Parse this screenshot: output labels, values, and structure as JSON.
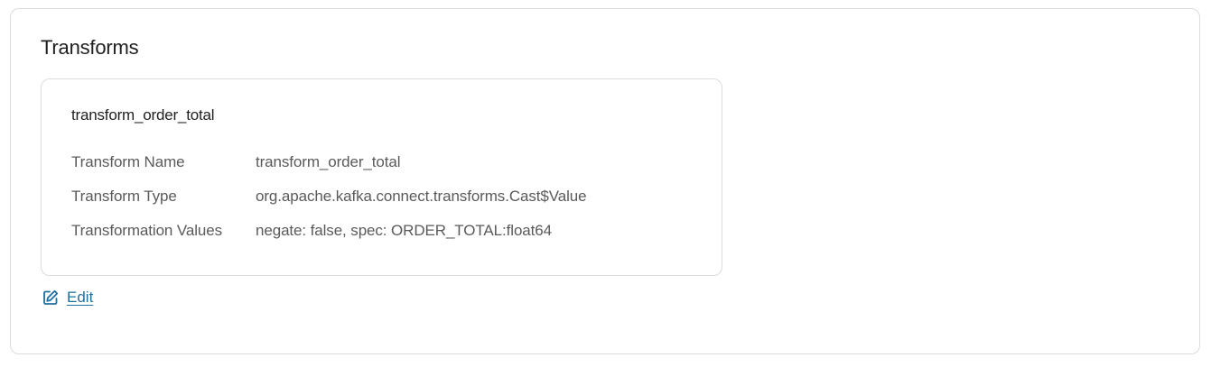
{
  "section": {
    "title": "Transforms"
  },
  "transform": {
    "title": "transform_order_total",
    "rows": [
      {
        "label": "Transform Name",
        "value": "transform_order_total"
      },
      {
        "label": "Transform Type",
        "value": "org.apache.kafka.connect.transforms.Cast$Value"
      },
      {
        "label": "Transformation Values",
        "value": "negate: false, spec: ORDER_TOTAL:float64"
      }
    ]
  },
  "actions": {
    "edit_label": "Edit",
    "edit_icon": "edit-icon"
  },
  "colors": {
    "border": "#dcdcdc",
    "link": "#1f6f9f",
    "title_text": "#1f1f1f",
    "body_text": "#5a5a5a"
  }
}
